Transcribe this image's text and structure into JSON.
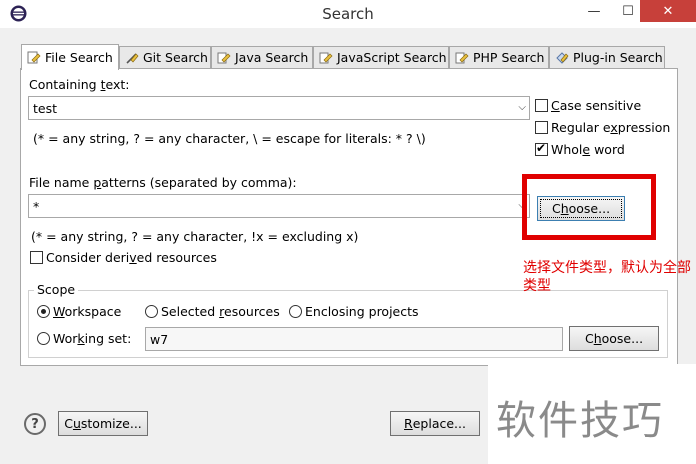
{
  "window": {
    "title": "Search",
    "minimize": "—",
    "maximize": "☐",
    "close": "✕"
  },
  "tabs": [
    {
      "label": "File Search",
      "active": true
    },
    {
      "label": "Git Search"
    },
    {
      "label": "Java Search"
    },
    {
      "label": "JavaScript Search"
    },
    {
      "label": "PHP Search"
    },
    {
      "label": "Plug-in Search"
    }
  ],
  "containing": {
    "label_pre": "Containing ",
    "label_key": "t",
    "label_post": "ext:",
    "value": "test",
    "hint": "(* = any string, ? = any character, \\ = escape for literals: * ? \\)"
  },
  "options": {
    "case_sensitive": {
      "pre": "",
      "key": "C",
      "post": "ase sensitive",
      "checked": false
    },
    "regex": {
      "pre": "Regular e",
      "key": "x",
      "post": "pression",
      "checked": false
    },
    "whole_word": {
      "pre": "Whol",
      "key": "e",
      "post": " word",
      "checked": true
    }
  },
  "patterns": {
    "label_pre": "File name ",
    "label_key": "p",
    "label_post": "atterns (separated by comma):",
    "value": "*",
    "choose_pre": "C",
    "choose_key": "h",
    "choose_post": "oose...",
    "hint": "(* = any string, ? = any character, !x = excluding x)"
  },
  "derived": {
    "pre": "Consider deri",
    "key": "v",
    "post": "ed resources",
    "checked": false
  },
  "scope": {
    "title": "Scope",
    "workspace": {
      "pre": "",
      "key": "W",
      "post": "orkspace",
      "selected": true
    },
    "selected_resources": {
      "pre": "Selected ",
      "key": "r",
      "post": "esources",
      "selected": false
    },
    "enclosing_projects": {
      "pre": "Enclosing projects",
      "key": "",
      "post": "",
      "selected": false
    },
    "working_set": {
      "pre": "Wor",
      "key": "k",
      "post": "ing set:",
      "selected": false,
      "value": "w7"
    },
    "choose_pre": "C",
    "choose_key": "h",
    "choose_post": "oose..."
  },
  "footer": {
    "help": "?",
    "customize_pre": "C",
    "customize_key": "u",
    "customize_post": "stomize...",
    "replace_pre": "",
    "replace_key": "R",
    "replace_post": "eplace..."
  },
  "annotation": {
    "text": "选择文件类型，默认为全部类型",
    "color": "#e00000"
  },
  "watermark": "软件技巧"
}
